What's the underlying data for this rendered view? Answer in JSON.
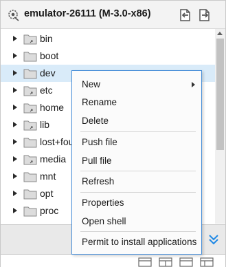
{
  "window": {
    "title": "emulator-26111 (M-3.0-x86)"
  },
  "toolbar": {
    "pull_icon": "pull-file-icon",
    "push_icon": "push-file-icon"
  },
  "tree": {
    "items": [
      {
        "label": "bin",
        "icon": "folder-link-icon"
      },
      {
        "label": "boot",
        "icon": "folder-icon"
      },
      {
        "label": "dev",
        "icon": "folder-icon",
        "selected": true
      },
      {
        "label": "etc",
        "icon": "folder-link-icon"
      },
      {
        "label": "home",
        "icon": "folder-link-icon"
      },
      {
        "label": "lib",
        "icon": "folder-link-icon"
      },
      {
        "label": "lost+fou",
        "icon": "folder-icon"
      },
      {
        "label": "media",
        "icon": "folder-link-icon"
      },
      {
        "label": "mnt",
        "icon": "folder-icon"
      },
      {
        "label": "opt",
        "icon": "folder-icon"
      },
      {
        "label": "proc",
        "icon": "folder-icon"
      }
    ]
  },
  "context_menu": {
    "items": [
      {
        "label": "New",
        "submenu": true
      },
      {
        "label": "Rename"
      },
      {
        "label": "Delete"
      },
      {
        "separator": true
      },
      {
        "label": "Push file"
      },
      {
        "label": "Pull file"
      },
      {
        "separator": true
      },
      {
        "label": "Refresh"
      },
      {
        "separator": true
      },
      {
        "label": "Properties"
      },
      {
        "label": "Open shell"
      },
      {
        "separator": true
      },
      {
        "label": "Permit to install applications"
      }
    ]
  },
  "colors": {
    "selection": "#d9ebf9",
    "menu_border": "#4a90d9",
    "accent_icon": "#1e88e5"
  }
}
